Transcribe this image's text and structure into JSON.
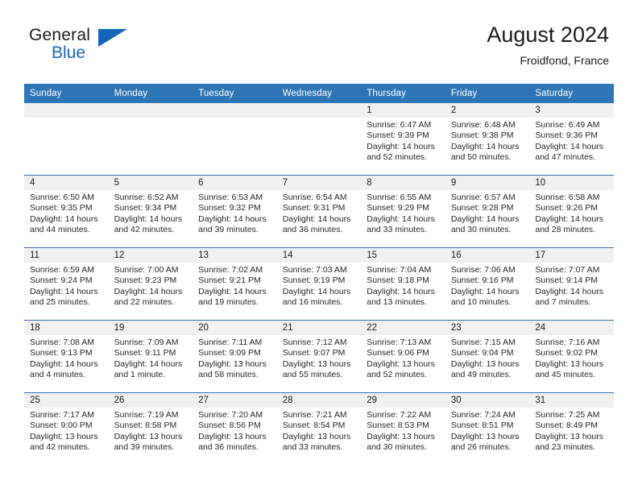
{
  "brand": {
    "name_part1": "General",
    "name_part2": "Blue",
    "logo_icon": "triangle-flag-icon",
    "accent_color": "#1565b8"
  },
  "header": {
    "title": "August 2024",
    "subtitle": "Froidfond, France"
  },
  "calendar": {
    "header_bg": "#2e75b6",
    "daynum_bg": "#f0f0f0",
    "weekday_headers": [
      "Sunday",
      "Monday",
      "Tuesday",
      "Wednesday",
      "Thursday",
      "Friday",
      "Saturday"
    ],
    "weeks": [
      [
        {
          "day": "",
          "sunrise": "",
          "sunset": "",
          "daylight1": "",
          "daylight2": "",
          "empty": true
        },
        {
          "day": "",
          "sunrise": "",
          "sunset": "",
          "daylight1": "",
          "daylight2": "",
          "empty": true
        },
        {
          "day": "",
          "sunrise": "",
          "sunset": "",
          "daylight1": "",
          "daylight2": "",
          "empty": true
        },
        {
          "day": "",
          "sunrise": "",
          "sunset": "",
          "daylight1": "",
          "daylight2": "",
          "empty": true
        },
        {
          "day": "1",
          "sunrise": "Sunrise: 6:47 AM",
          "sunset": "Sunset: 9:39 PM",
          "daylight1": "Daylight: 14 hours",
          "daylight2": "and 52 minutes."
        },
        {
          "day": "2",
          "sunrise": "Sunrise: 6:48 AM",
          "sunset": "Sunset: 9:38 PM",
          "daylight1": "Daylight: 14 hours",
          "daylight2": "and 50 minutes."
        },
        {
          "day": "3",
          "sunrise": "Sunrise: 6:49 AM",
          "sunset": "Sunset: 9:36 PM",
          "daylight1": "Daylight: 14 hours",
          "daylight2": "and 47 minutes."
        }
      ],
      [
        {
          "day": "4",
          "sunrise": "Sunrise: 6:50 AM",
          "sunset": "Sunset: 9:35 PM",
          "daylight1": "Daylight: 14 hours",
          "daylight2": "and 44 minutes."
        },
        {
          "day": "5",
          "sunrise": "Sunrise: 6:52 AM",
          "sunset": "Sunset: 9:34 PM",
          "daylight1": "Daylight: 14 hours",
          "daylight2": "and 42 minutes."
        },
        {
          "day": "6",
          "sunrise": "Sunrise: 6:53 AM",
          "sunset": "Sunset: 9:32 PM",
          "daylight1": "Daylight: 14 hours",
          "daylight2": "and 39 minutes."
        },
        {
          "day": "7",
          "sunrise": "Sunrise: 6:54 AM",
          "sunset": "Sunset: 9:31 PM",
          "daylight1": "Daylight: 14 hours",
          "daylight2": "and 36 minutes."
        },
        {
          "day": "8",
          "sunrise": "Sunrise: 6:55 AM",
          "sunset": "Sunset: 9:29 PM",
          "daylight1": "Daylight: 14 hours",
          "daylight2": "and 33 minutes."
        },
        {
          "day": "9",
          "sunrise": "Sunrise: 6:57 AM",
          "sunset": "Sunset: 9:28 PM",
          "daylight1": "Daylight: 14 hours",
          "daylight2": "and 30 minutes."
        },
        {
          "day": "10",
          "sunrise": "Sunrise: 6:58 AM",
          "sunset": "Sunset: 9:26 PM",
          "daylight1": "Daylight: 14 hours",
          "daylight2": "and 28 minutes."
        }
      ],
      [
        {
          "day": "11",
          "sunrise": "Sunrise: 6:59 AM",
          "sunset": "Sunset: 9:24 PM",
          "daylight1": "Daylight: 14 hours",
          "daylight2": "and 25 minutes."
        },
        {
          "day": "12",
          "sunrise": "Sunrise: 7:00 AM",
          "sunset": "Sunset: 9:23 PM",
          "daylight1": "Daylight: 14 hours",
          "daylight2": "and 22 minutes."
        },
        {
          "day": "13",
          "sunrise": "Sunrise: 7:02 AM",
          "sunset": "Sunset: 9:21 PM",
          "daylight1": "Daylight: 14 hours",
          "daylight2": "and 19 minutes."
        },
        {
          "day": "14",
          "sunrise": "Sunrise: 7:03 AM",
          "sunset": "Sunset: 9:19 PM",
          "daylight1": "Daylight: 14 hours",
          "daylight2": "and 16 minutes."
        },
        {
          "day": "15",
          "sunrise": "Sunrise: 7:04 AM",
          "sunset": "Sunset: 9:18 PM",
          "daylight1": "Daylight: 14 hours",
          "daylight2": "and 13 minutes."
        },
        {
          "day": "16",
          "sunrise": "Sunrise: 7:06 AM",
          "sunset": "Sunset: 9:16 PM",
          "daylight1": "Daylight: 14 hours",
          "daylight2": "and 10 minutes."
        },
        {
          "day": "17",
          "sunrise": "Sunrise: 7:07 AM",
          "sunset": "Sunset: 9:14 PM",
          "daylight1": "Daylight: 14 hours",
          "daylight2": "and 7 minutes."
        }
      ],
      [
        {
          "day": "18",
          "sunrise": "Sunrise: 7:08 AM",
          "sunset": "Sunset: 9:13 PM",
          "daylight1": "Daylight: 14 hours",
          "daylight2": "and 4 minutes."
        },
        {
          "day": "19",
          "sunrise": "Sunrise: 7:09 AM",
          "sunset": "Sunset: 9:11 PM",
          "daylight1": "Daylight: 14 hours",
          "daylight2": "and 1 minute."
        },
        {
          "day": "20",
          "sunrise": "Sunrise: 7:11 AM",
          "sunset": "Sunset: 9:09 PM",
          "daylight1": "Daylight: 13 hours",
          "daylight2": "and 58 minutes."
        },
        {
          "day": "21",
          "sunrise": "Sunrise: 7:12 AM",
          "sunset": "Sunset: 9:07 PM",
          "daylight1": "Daylight: 13 hours",
          "daylight2": "and 55 minutes."
        },
        {
          "day": "22",
          "sunrise": "Sunrise: 7:13 AM",
          "sunset": "Sunset: 9:06 PM",
          "daylight1": "Daylight: 13 hours",
          "daylight2": "and 52 minutes."
        },
        {
          "day": "23",
          "sunrise": "Sunrise: 7:15 AM",
          "sunset": "Sunset: 9:04 PM",
          "daylight1": "Daylight: 13 hours",
          "daylight2": "and 49 minutes."
        },
        {
          "day": "24",
          "sunrise": "Sunrise: 7:16 AM",
          "sunset": "Sunset: 9:02 PM",
          "daylight1": "Daylight: 13 hours",
          "daylight2": "and 45 minutes."
        }
      ],
      [
        {
          "day": "25",
          "sunrise": "Sunrise: 7:17 AM",
          "sunset": "Sunset: 9:00 PM",
          "daylight1": "Daylight: 13 hours",
          "daylight2": "and 42 minutes."
        },
        {
          "day": "26",
          "sunrise": "Sunrise: 7:19 AM",
          "sunset": "Sunset: 8:58 PM",
          "daylight1": "Daylight: 13 hours",
          "daylight2": "and 39 minutes."
        },
        {
          "day": "27",
          "sunrise": "Sunrise: 7:20 AM",
          "sunset": "Sunset: 8:56 PM",
          "daylight1": "Daylight: 13 hours",
          "daylight2": "and 36 minutes."
        },
        {
          "day": "28",
          "sunrise": "Sunrise: 7:21 AM",
          "sunset": "Sunset: 8:54 PM",
          "daylight1": "Daylight: 13 hours",
          "daylight2": "and 33 minutes."
        },
        {
          "day": "29",
          "sunrise": "Sunrise: 7:22 AM",
          "sunset": "Sunset: 8:53 PM",
          "daylight1": "Daylight: 13 hours",
          "daylight2": "and 30 minutes."
        },
        {
          "day": "30",
          "sunrise": "Sunrise: 7:24 AM",
          "sunset": "Sunset: 8:51 PM",
          "daylight1": "Daylight: 13 hours",
          "daylight2": "and 26 minutes."
        },
        {
          "day": "31",
          "sunrise": "Sunrise: 7:25 AM",
          "sunset": "Sunset: 8:49 PM",
          "daylight1": "Daylight: 13 hours",
          "daylight2": "and 23 minutes."
        }
      ]
    ]
  }
}
